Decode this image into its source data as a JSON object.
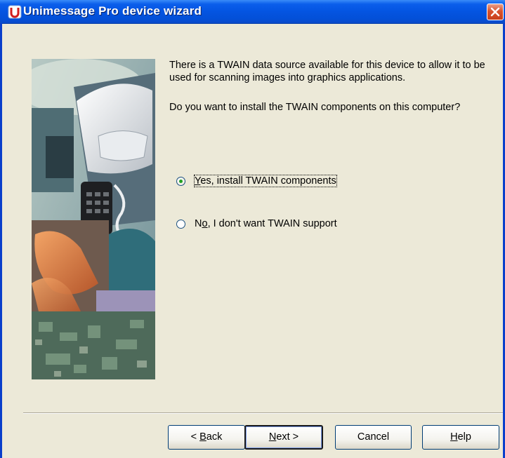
{
  "window": {
    "title": "Unimessage Pro device wizard",
    "icon": "app-icon",
    "close_icon": "close-icon"
  },
  "intro_text": "There is a TWAIN data source available for this device to allow it to be used for scanning images into graphics applications.",
  "question_text": "Do you want to install the TWAIN components on this computer?",
  "options": [
    {
      "pre": "",
      "mnemonic": "Y",
      "post": "es, install TWAIN components",
      "selected": true
    },
    {
      "pre": "N",
      "mnemonic": "o",
      "post": ", I don't want TWAIN support",
      "selected": false
    }
  ],
  "buttons": {
    "back": {
      "pre": "< ",
      "mnemonic": "B",
      "post": "ack"
    },
    "next": {
      "pre": "",
      "mnemonic": "N",
      "post": "ext >"
    },
    "cancel": {
      "label": "Cancel"
    },
    "help": {
      "pre": "",
      "mnemonic": "H",
      "post": "elp"
    }
  },
  "colors": {
    "titlebar": "#0454E1",
    "dialog_bg": "#ECE9D8",
    "close_button": "#D9532E"
  }
}
